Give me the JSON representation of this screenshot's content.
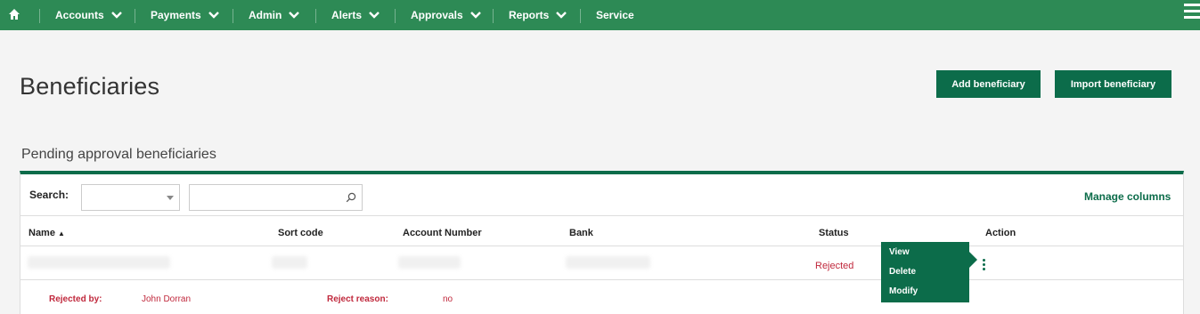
{
  "nav": {
    "items": [
      {
        "label": "Accounts"
      },
      {
        "label": "Payments"
      },
      {
        "label": "Admin"
      },
      {
        "label": "Alerts"
      },
      {
        "label": "Approvals"
      },
      {
        "label": "Reports"
      },
      {
        "label": "Service"
      }
    ]
  },
  "page": {
    "title": "Beneficiaries",
    "add_label": "Add beneficiary",
    "import_label": "Import beneficiary",
    "section_title": "Pending approval beneficiaries"
  },
  "search": {
    "label": "Search:",
    "select_value": "",
    "query": "",
    "manage_columns": "Manage columns"
  },
  "table": {
    "headers": {
      "name": "Name",
      "sort_code": "Sort code",
      "account_number": "Account Number",
      "bank": "Bank",
      "status": "Status",
      "action": "Action"
    },
    "rows": [
      {
        "status": "Rejected",
        "rejected_by_label": "Rejected by:",
        "rejected_by": "John Dorran",
        "reject_reason_label": "Reject reason:",
        "reject_reason": "no"
      }
    ]
  },
  "action_menu": {
    "items": [
      {
        "label": "View"
      },
      {
        "label": "Delete"
      },
      {
        "label": "Modify"
      }
    ]
  },
  "colors": {
    "nav_bg": "#2d8a55",
    "primary": "#0c6c4a",
    "danger": "#c0283c"
  }
}
